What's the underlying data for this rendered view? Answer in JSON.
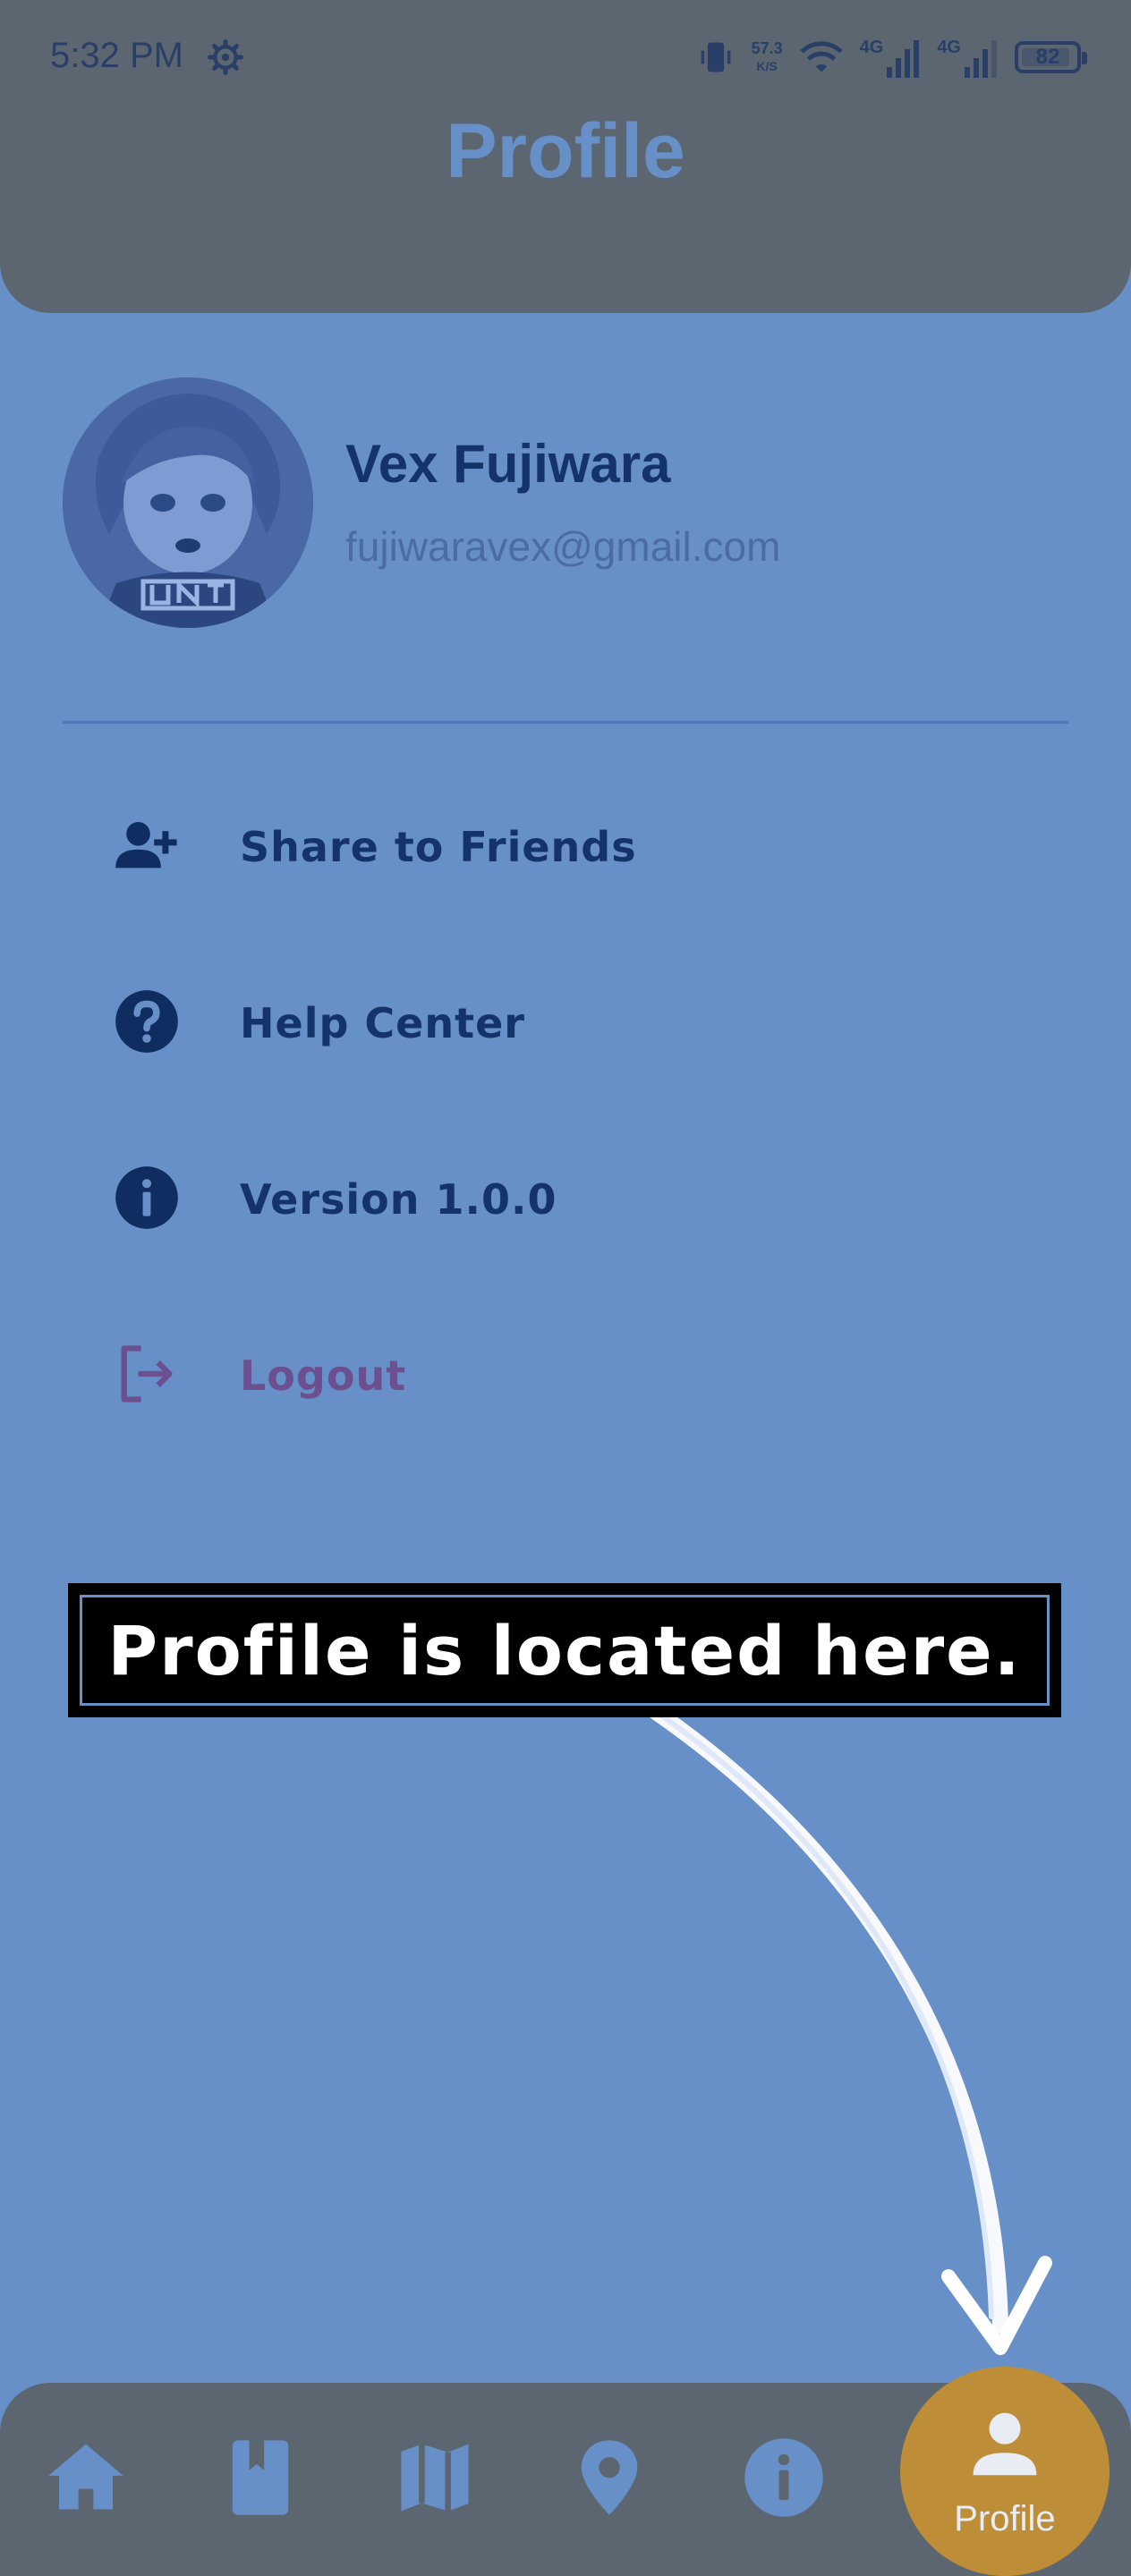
{
  "status_bar": {
    "time": "5:32 PM",
    "speed_value": "57.3",
    "speed_unit": "K/S",
    "net1": "4G",
    "net2": "4G",
    "battery": "82",
    "icons": [
      "gear-icon",
      "vibrate-icon",
      "wifi-icon",
      "signal-icon",
      "signal-icon",
      "battery-icon"
    ]
  },
  "header": {
    "title": "Profile"
  },
  "profile": {
    "name": "Vex Fujiwara",
    "email": "fujiwaravex@gmail.com"
  },
  "menu": [
    {
      "label": "Share to Friends",
      "icon": "add-person-icon"
    },
    {
      "label": "Help Center",
      "icon": "help-icon"
    },
    {
      "label": "Version 1.0.0",
      "icon": "info-icon"
    },
    {
      "label": "Logout",
      "icon": "logout-icon"
    }
  ],
  "callout": {
    "text": "Profile is located here."
  },
  "bottom_nav": {
    "items": [
      "home-icon",
      "book-icon",
      "map-icon",
      "location-icon",
      "info-icon",
      "person-icon"
    ],
    "active_label": "Profile"
  },
  "colors": {
    "background": "#6890c8",
    "header": "#5b6670",
    "active_tab": "#be8d38",
    "text_primary": "#13336a",
    "logout": "#6b4f8e"
  }
}
